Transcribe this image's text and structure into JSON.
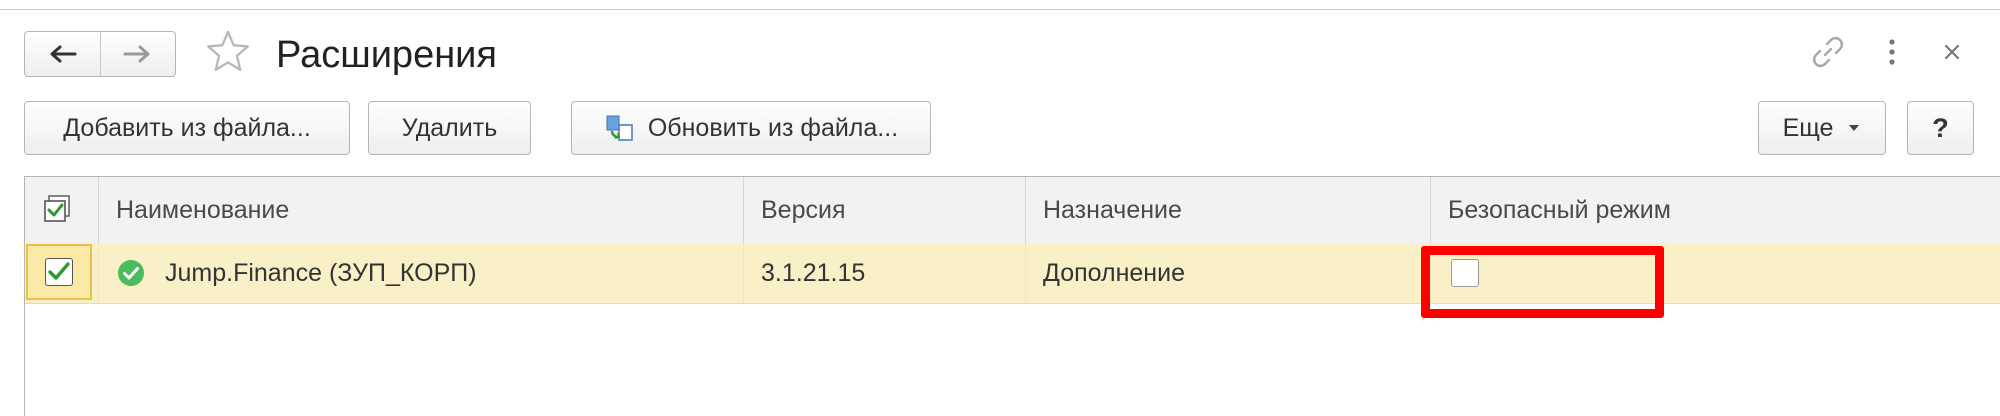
{
  "window": {
    "title": "Расширения",
    "icons": [
      "back-arrow-icon",
      "forward-arrow-icon",
      "favorite-star-icon",
      "link-icon",
      "more-vertical-icon",
      "close-icon"
    ]
  },
  "toolbar": {
    "add_label": "Добавить из файла...",
    "delete_label": "Удалить",
    "update_label": "Обновить из файла...",
    "more_label": "Еще",
    "help_label": "?"
  },
  "table": {
    "columns": [
      "Наименование",
      "Версия",
      "Назначение",
      "Безопасный режим"
    ],
    "rows": [
      {
        "active": true,
        "name": "Jump.Finance (ЗУП_КОРП)",
        "version": "3.1.21.15",
        "purpose": "Дополнение",
        "safe_mode": false
      }
    ]
  },
  "colors": {
    "selected_row": "#faf0c8",
    "header_bg": "#f2f2f2",
    "highlight": "#ff0000",
    "check_green": "#2a9a2a"
  }
}
